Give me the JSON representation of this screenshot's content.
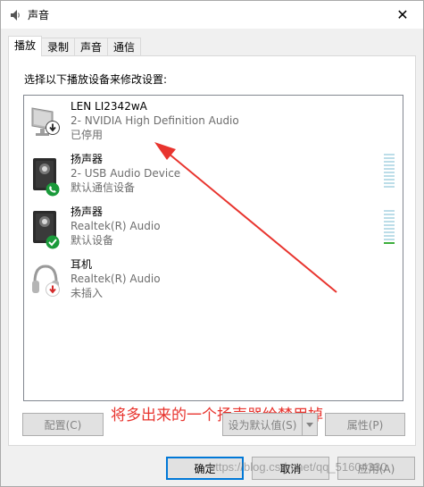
{
  "window": {
    "title": "声音",
    "close_glyph": "✕"
  },
  "tabs": [
    {
      "label": "播放",
      "active": true
    },
    {
      "label": "录制",
      "active": false
    },
    {
      "label": "声音",
      "active": false
    },
    {
      "label": "通信",
      "active": false
    }
  ],
  "instruction": "选择以下播放设备来修改设置:",
  "devices": [
    {
      "name": "LEN LI2342wA",
      "sub": "2- NVIDIA High Definition Audio",
      "status": "已停用",
      "icon": "monitor-icon",
      "badge": "disabled-down-arrow-icon"
    },
    {
      "name": "扬声器",
      "sub": "2- USB Audio Device",
      "status": "默认通信设备",
      "icon": "speaker-icon",
      "badge": "phone-badge-icon"
    },
    {
      "name": "扬声器",
      "sub": "Realtek(R) Audio",
      "status": "默认设备",
      "icon": "speaker-icon",
      "badge": "check-badge-icon"
    },
    {
      "name": "耳机",
      "sub": "Realtek(R) Audio",
      "status": "未插入",
      "icon": "headphones-icon",
      "badge": "unplugged-arrow-icon"
    }
  ],
  "annotation": "将多出来的一个扬声器给禁用掉",
  "buttons": {
    "configure": "配置(C)",
    "set_default": "设为默认值(S)",
    "properties": "属性(P)",
    "ok": "确定",
    "cancel": "取消",
    "apply": "应用(A)"
  },
  "watermark": "https://blog.csdn.net/qq_51604330",
  "colors": {
    "annotation": "#e8342e",
    "accent": "#0078d7",
    "meter_green": "#3cae3c",
    "meter_idle": "#bcdde8"
  }
}
